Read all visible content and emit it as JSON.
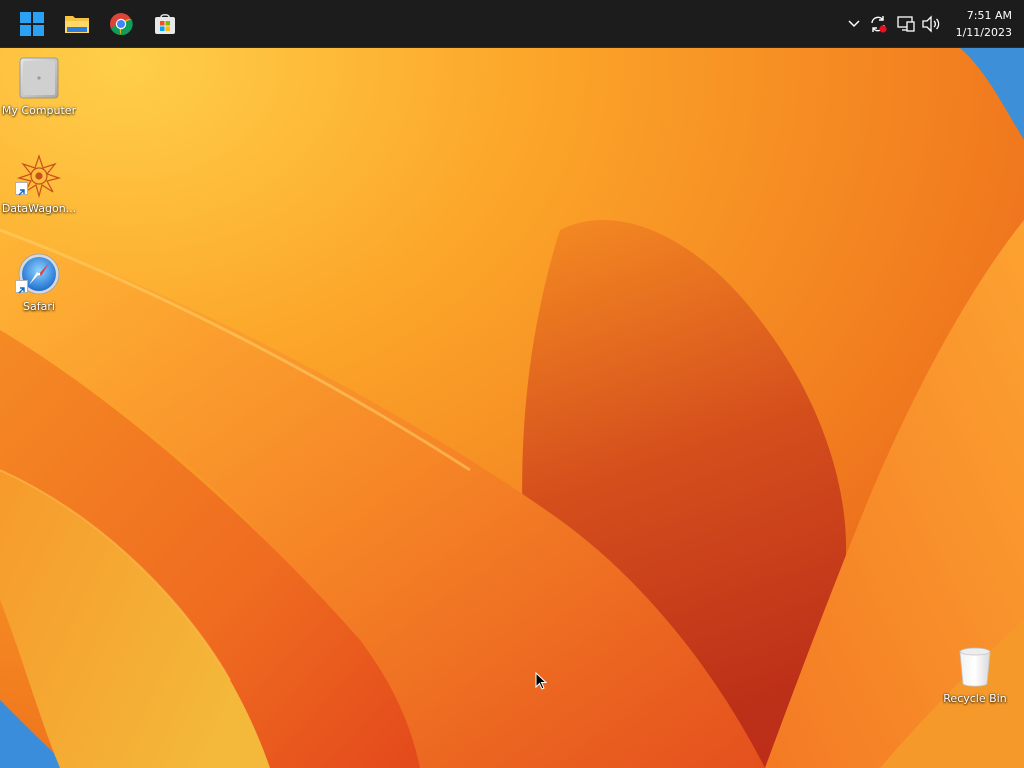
{
  "taskbar": {
    "pinned": [
      {
        "name": "start-button",
        "icon": "windows-logo-icon"
      },
      {
        "name": "file-explorer-button",
        "icon": "folder-icon"
      },
      {
        "name": "chrome-button",
        "icon": "chrome-icon"
      },
      {
        "name": "microsoft-store-button",
        "icon": "store-icon"
      }
    ],
    "tray": {
      "icons": [
        "chevron-up-icon",
        "sync-icon",
        "network-icon",
        "volume-icon"
      ],
      "time": "7:51 AM",
      "date": "1/11/2023"
    }
  },
  "desktop": {
    "icons": [
      {
        "label": "My Computer",
        "icon": "computer-icon"
      },
      {
        "label": "DataWagon...",
        "icon": "datawagon-icon"
      },
      {
        "label": "Safari",
        "icon": "safari-compass-icon"
      },
      {
        "label": "Recycle Bin",
        "icon": "recycle-bin-icon"
      }
    ]
  },
  "colors": {
    "taskbar": "#1c1c1c",
    "wallpaper_light": "#fbb42e",
    "wallpaper_mid": "#f27d1d",
    "wallpaper_dark": "#c43219",
    "windows_blue": "#2aa1f3"
  }
}
